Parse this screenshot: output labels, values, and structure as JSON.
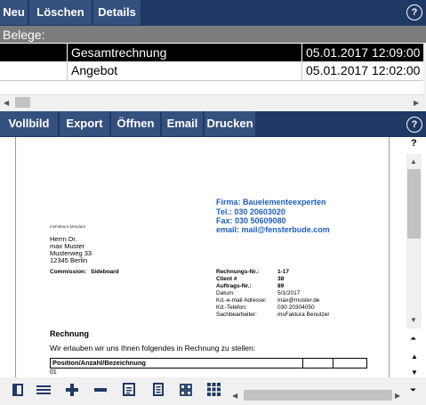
{
  "top_toolbar": {
    "buttons": [
      "Neu",
      "Löschen",
      "Details"
    ],
    "help": "?"
  },
  "belege": {
    "label": "Belege:",
    "rows": [
      {
        "name": "Gesamtrechnung",
        "date": "05.01.2017 12:09:00",
        "selected": true
      },
      {
        "name": "Angebot",
        "date": "05.01.2017 12:02:00",
        "selected": false
      }
    ]
  },
  "preview_toolbar": {
    "buttons": [
      "Vollbild",
      "Export",
      "Öffnen",
      "Email",
      "Drucken"
    ],
    "help": "?"
  },
  "side_question": "?",
  "document": {
    "company": {
      "firma": "Firma: Bauelementeexperten",
      "tel": "Tel.: 030 20603020",
      "fax": "Fax: 030 50609080",
      "email": "email: mail@fensterbude.com"
    },
    "sender": "msFaktura Mandant",
    "address": [
      "Herrn Dr.",
      "max Muster",
      "Musterweg 33",
      "12345 Berlin"
    ],
    "commission_label": "Commission:",
    "commission_value": "Sideboard",
    "info": [
      {
        "label": "Rechnungs-Nr.:",
        "value": "1-17",
        "bold": true
      },
      {
        "label": "Client #",
        "value": "38",
        "bold": true
      },
      {
        "label": "Auftrags-Nr.:",
        "value": "89",
        "bold": true
      },
      {
        "label": "Datum:",
        "value": "5/1/2017",
        "bold": false
      },
      {
        "label": "Kd.-e-mail Adresse:",
        "value": "max@muster.de",
        "bold": false
      },
      {
        "label": "Kd.-Telefon:",
        "value": "030 20304050",
        "bold": false
      },
      {
        "label": "Sachbearbeiter:",
        "value": "msFaktura Benutzer",
        "bold": false
      }
    ],
    "heading": "Rechnung",
    "intro": "Wir erlauben wir uns Ihnen folgendes in Rechnung zu stellen:",
    "table_header": "Position/Anzahl/Bezeichnung",
    "first_row": "01"
  },
  "bottom_icons": [
    "sidebar-icon",
    "menu-icon",
    "zoom-in-icon",
    "zoom-out-icon",
    "single-page-icon",
    "page-view-icon",
    "grid-2-icon",
    "grid-3-icon"
  ],
  "colors": {
    "toolbar": "#1f3864",
    "button": "#34507f",
    "selection": "#000000",
    "link_blue": "#1f5fbf"
  }
}
